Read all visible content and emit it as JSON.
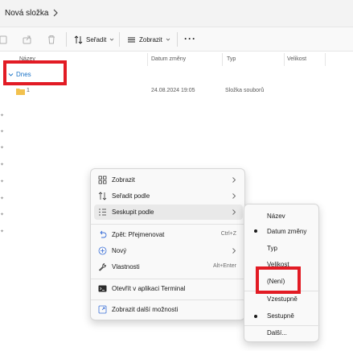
{
  "address": {
    "crumb": "Nová složka"
  },
  "toolbar": {
    "sort_label": "Seřadit",
    "view_label": "Zobrazit",
    "more_label": "···"
  },
  "columns": {
    "name": "Název",
    "date": "Datum změny",
    "type": "Typ",
    "size": "Velikost"
  },
  "group": {
    "label": "Dnes"
  },
  "files": [
    {
      "name": "1",
      "date": "24.08.2024 19:05",
      "type": "Složka souborů",
      "icon": "folder-icon"
    }
  ],
  "context_menu": {
    "items": [
      {
        "label": "Zobrazit",
        "icon": "grid-icon",
        "submenu": true
      },
      {
        "label": "Seřadit podle",
        "icon": "sort-icon",
        "submenu": true
      },
      {
        "label": "Seskupit podle",
        "icon": "group-icon",
        "submenu": true,
        "highlighted": true
      },
      {
        "label": "Zpět: Přejmenovat",
        "icon": "undo-icon",
        "shortcut": "Ctrl+Z"
      },
      {
        "label": "Nový",
        "icon": "plus-circle-icon",
        "submenu": true
      },
      {
        "label": "Vlastnosti",
        "icon": "wrench-icon",
        "shortcut": "Alt+Enter"
      },
      {
        "label": "Otevřít v aplikaci Terminal",
        "icon": "terminal-icon"
      },
      {
        "label": "Zobrazit další možnosti",
        "icon": "more-options-icon"
      }
    ]
  },
  "group_submenu": {
    "items": [
      {
        "label": "Název",
        "checked": false
      },
      {
        "label": "Datum změny",
        "checked": true
      },
      {
        "label": "Typ",
        "checked": false
      },
      {
        "label": "Velikost",
        "checked": false
      },
      {
        "label": "(Není)",
        "checked": false
      }
    ],
    "order": [
      {
        "label": "Vzestupně",
        "checked": false
      },
      {
        "label": "Sestupně",
        "checked": true
      }
    ],
    "more_label": "Další..."
  },
  "colors": {
    "accent": "#1a73c7",
    "highlight_box": "#e21b24",
    "folder": "#f2c14e"
  }
}
